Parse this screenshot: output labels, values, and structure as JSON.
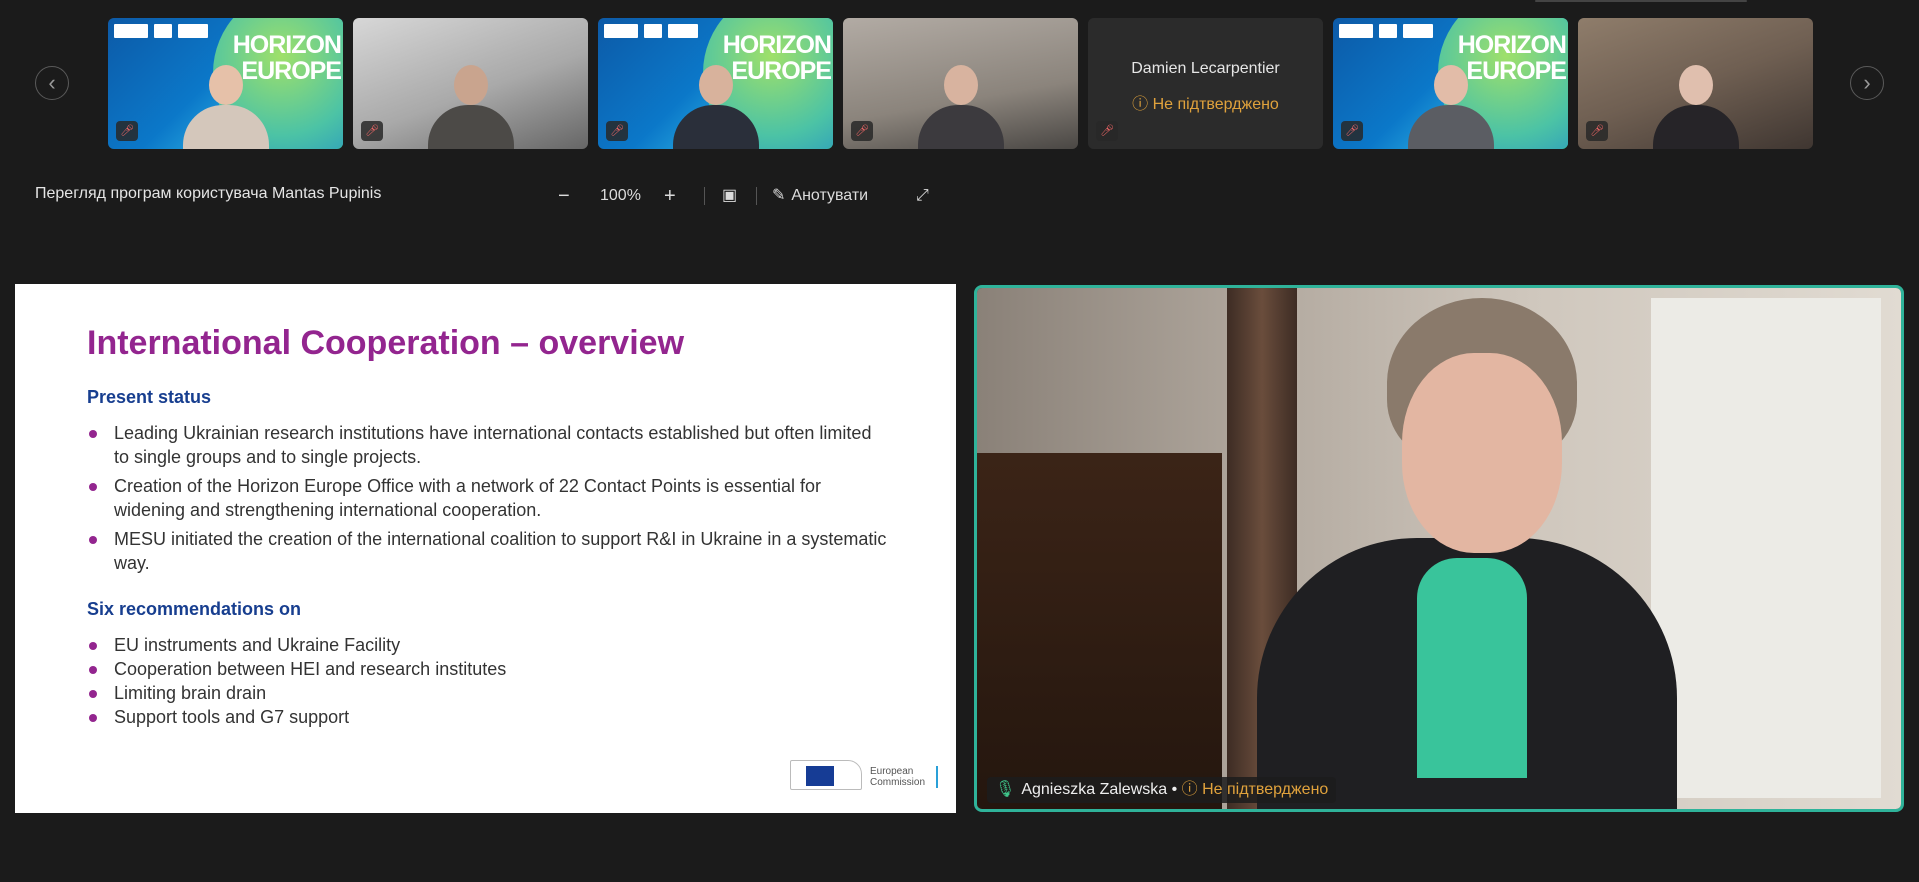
{
  "gallery": {
    "prev_icon": "‹",
    "next_icon": "›",
    "tiles": [
      {
        "kind": "horizon",
        "brand_text": "HORIZON\nEUROPE",
        "skin": "#e6c1a9",
        "shirt": "#d4c7bb"
      },
      {
        "kind": "room1",
        "skin": "#c9a48e",
        "shirt": "#4c4a47"
      },
      {
        "kind": "horizon",
        "brand_text": "HORIZON\nEUROPE",
        "skin": "#d8b29c",
        "shirt": "#2a2f3a"
      },
      {
        "kind": "room2",
        "skin": "#d8b39f",
        "shirt": "#3c3a3e"
      },
      {
        "kind": "grey",
        "name": "Damien Lecarpentier",
        "status": "ⓘ Не підтверджено"
      },
      {
        "kind": "horizon",
        "brand_text": "HORIZON\nEUROPE",
        "skin": "#e2bca8",
        "shirt": "#5b5d63"
      },
      {
        "kind": "room3",
        "skin": "#e0bfae",
        "shirt": "#262428"
      }
    ],
    "mic_off_icon": "🎤︎"
  },
  "toolbar": {
    "title": "Перегляд програм користувача Mantas Pupinis",
    "zoom_out": "−",
    "zoom_level": "100%",
    "zoom_in": "+",
    "screen_icon": "▣",
    "annotate": "Анотувати",
    "fullscreen_icon": "⤢"
  },
  "slide": {
    "title": "International Cooperation – overview",
    "section1_title": "Present status",
    "section1_items": [
      "Leading Ukrainian research institutions have international contacts established but often limited to single groups and to single projects.",
      "Creation of the Horizon Europe Office with a network of 22 Contact Points is essential for widening and strengthening international cooperation.",
      "MESU initiated the creation of the international coalition to support R&I in Ukraine in a systematic way."
    ],
    "section2_title": "Six recommendations on",
    "section2_items": [
      "EU instruments and Ukraine Facility",
      "Cooperation between HEI and research institutes",
      "Limiting brain drain",
      "Support tools and G7 support"
    ],
    "logo_text_line1": "European",
    "logo_text_line2": "Commission"
  },
  "speaker": {
    "name": "Agnieszka Zalewska",
    "separator": " • ",
    "status": "ⓘ Не підтверджено",
    "mic_icon": "🎙︎",
    "accent_color": "#2fb39a"
  }
}
